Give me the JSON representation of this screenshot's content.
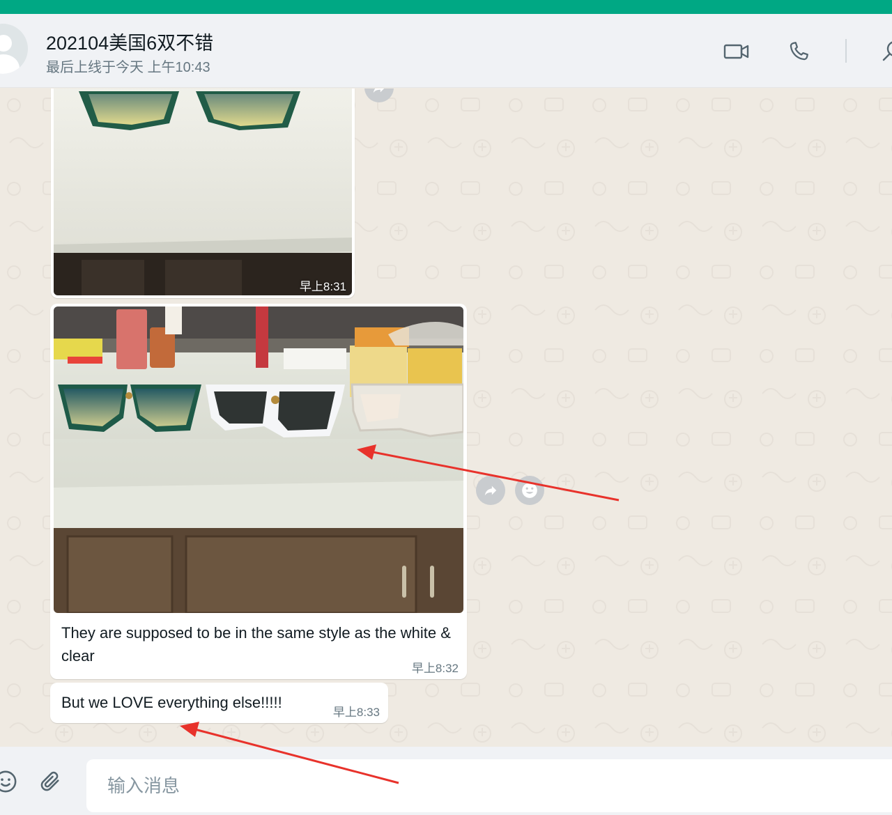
{
  "header": {
    "contact_name": "202104美国6双不错",
    "status": "最后上线于今天 上午10:43",
    "icons": [
      "video-call-icon",
      "voice-call-icon",
      "search-icon"
    ]
  },
  "messages": [
    {
      "type": "image",
      "time": "早上8:31"
    },
    {
      "type": "image",
      "text": "They are supposed to be in the same style as the white & clear",
      "time": "早上8:32"
    },
    {
      "type": "text",
      "text": "But we LOVE everything else!!!!!",
      "time": "早上8:33"
    }
  ],
  "footer": {
    "placeholder": "输入消息",
    "icons": [
      "emoji-icon",
      "attach-icon"
    ]
  },
  "colors": {
    "brand": "#00a884",
    "annotation_arrow": "#e8322b"
  }
}
